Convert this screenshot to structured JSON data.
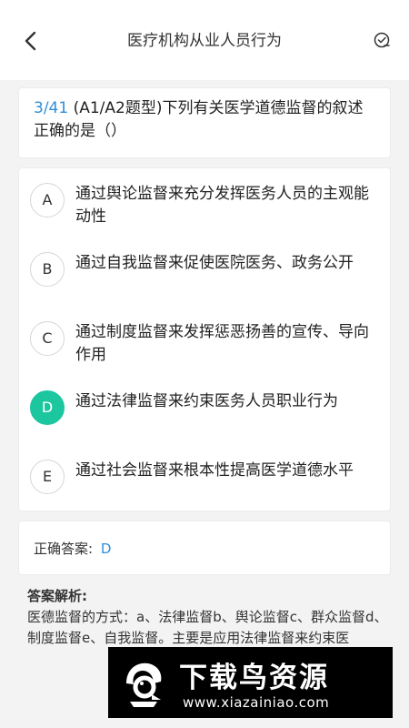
{
  "header": {
    "title": "医疗机构从业人员行为"
  },
  "question": {
    "index": "3/41",
    "text": "(A1/A2题型)下列有关医学道德监督的叙述正确的是（）"
  },
  "options": [
    {
      "letter": "A",
      "text": "通过舆论监督来充分发挥医务人员的主观能动性",
      "selected": false
    },
    {
      "letter": "B",
      "text": "通过自我监督来促使医院医务、政务公开",
      "selected": false
    },
    {
      "letter": "C",
      "text": "通过制度监督来发挥惩恶扬善的宣传、导向作用",
      "selected": false
    },
    {
      "letter": "D",
      "text": "通过法律监督来约束医务人员职业行为",
      "selected": true
    },
    {
      "letter": "E",
      "text": "通过社会监督来根本性提高医学道德水平",
      "selected": false
    }
  ],
  "answer": {
    "label": "正确答案:",
    "value": "D"
  },
  "analysis": {
    "label": "答案解析:",
    "text": "医德监督的方式：a、法律监督b、舆论监督c、群众监督d、制度监督e、自我监督。主要是应用法律监督来约束医"
  },
  "watermark": {
    "title": "下载鸟资源",
    "url": "www.xiazainiao.com"
  },
  "colors": {
    "accent_blue": "#2f8fd8",
    "selected_green": "#1cc7a0"
  }
}
